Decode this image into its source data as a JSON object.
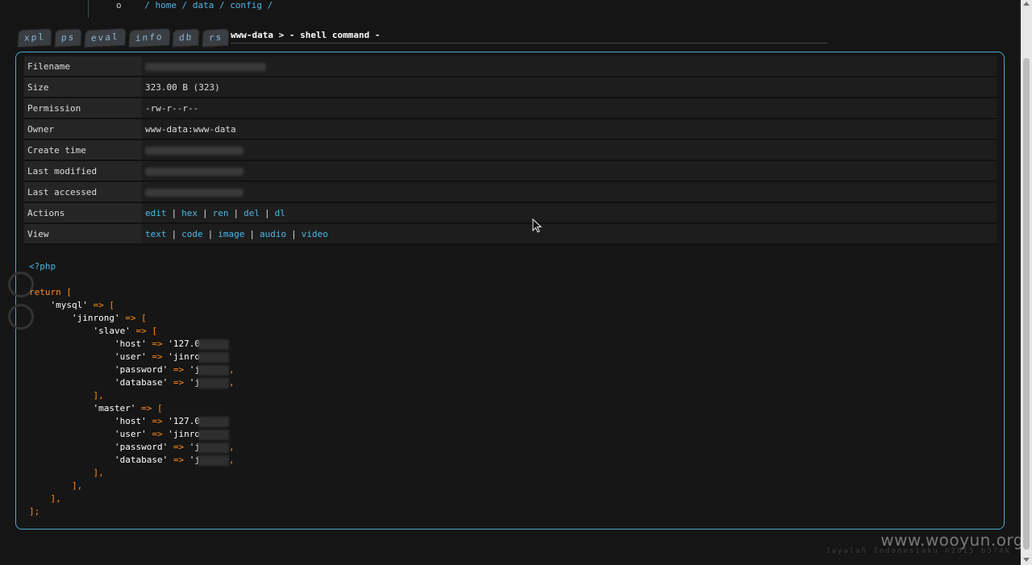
{
  "header": {
    "path_prefix": "o",
    "path": [
      {
        "sep": "/",
        "label": "home"
      },
      {
        "sep": "/",
        "label": "data"
      },
      {
        "sep": "/",
        "label": "config"
      },
      {
        "sep": "/",
        "label": ""
      }
    ]
  },
  "tabs": [
    "xpl",
    "ps",
    "eval",
    "info",
    "db",
    "rs"
  ],
  "prompt": {
    "user": "www-data >",
    "text": " - shell command -"
  },
  "file_info": {
    "rows": [
      {
        "key": "Filename",
        "value": ""
      },
      {
        "key": "Size",
        "value": "323.00 B (323)"
      },
      {
        "key": "Permission",
        "value": "-rw-r--r--"
      },
      {
        "key": "Owner",
        "value": "www-data:www-data"
      },
      {
        "key": "Create time",
        "value": ""
      },
      {
        "key": "Last modified",
        "value": ""
      },
      {
        "key": "Last accessed",
        "value": ""
      }
    ],
    "actions_label": "Actions",
    "actions": [
      "edit",
      "hex",
      "ren",
      "del",
      "dl"
    ],
    "view_label": "View",
    "views": [
      "text",
      "code",
      "image",
      "audio",
      "video"
    ]
  },
  "code": {
    "open_tag": "<?php",
    "return_kw": "return",
    "arrow": "=>",
    "key_mysql": "'mysql'",
    "key_jinrong": "'jinrong'",
    "key_slave": "'slave'",
    "key_master": "'master'",
    "key_host": "'host'",
    "key_user": "'user'",
    "key_password": "'password'",
    "key_database": "'database'",
    "val_host": "'127.0",
    "val_user": "'jinro",
    "val_password": "'j",
    "val_database": "'j"
  },
  "watermark": "www.wooyun.org",
  "footer": "Jayalah Indonesiaku ©2015 b374k",
  "colors": {
    "accent": "#4db7e8",
    "keyword": "#ff8a1f",
    "panel_border": "#4aa7cf"
  }
}
